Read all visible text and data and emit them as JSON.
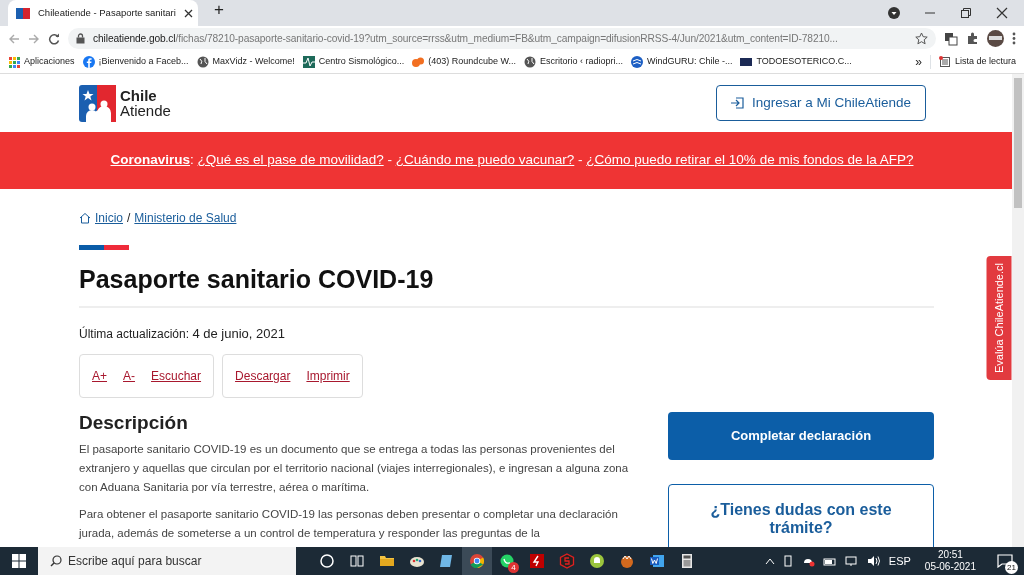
{
  "browser": {
    "tabs": [
      {
        "title": "Chileatiende - Pasaporte sanitari",
        "selected": true
      }
    ],
    "new_tab": "+",
    "url_host": "chileatiende.gob.cl",
    "url_path": "/fichas/78210-pasaporte-sanitario-covid-19?utm_source=rrss&utm_medium=FB&utm_campaign=difusionRRSS-4/Jun/2021&utm_content=ID-78210...",
    "bookmarks": [
      {
        "label": "Aplicaciones",
        "kind": "apps"
      },
      {
        "label": "¡Bienvenido a Faceb...",
        "kind": "social"
      },
      {
        "label": "MaxVidz - Welcome!",
        "kind": "globe"
      },
      {
        "label": "Centro Sismológico...",
        "kind": "seismo"
      },
      {
        "label": "(403) Roundcube W...",
        "kind": "mail"
      },
      {
        "label": "Escritorio ‹ radiopri...",
        "kind": "globe"
      },
      {
        "label": "WindGURU: Chile -...",
        "kind": "wind"
      },
      {
        "label": "TODOESOTERICO.C...",
        "kind": "badge"
      }
    ],
    "overflow": "»",
    "reading_list": "Lista de lectura"
  },
  "site": {
    "logo_top": "Chile",
    "logo_bottom": "Atiende",
    "login_button": "Ingresar a Mi ChileAtiende",
    "alert": [
      {
        "kind": "strong-link",
        "text": "Coronavirus"
      },
      {
        "kind": "text",
        "text": ": "
      },
      {
        "kind": "link",
        "text": "¿Qué es el pase de movilidad?"
      },
      {
        "kind": "text",
        "text": " - "
      },
      {
        "kind": "link",
        "text": "¿Cuándo me puedo vacunar?"
      },
      {
        "kind": "text",
        "text": " - "
      },
      {
        "kind": "link",
        "text": "¿Cómo puedo retirar el 10% de mis fondos de la AFP?"
      }
    ],
    "breadcrumb": [
      {
        "label": "Inicio"
      },
      {
        "label": "Ministerio de Salud"
      }
    ],
    "breadcrumb_separator": "/",
    "title": "Pasaporte sanitario COVID-19",
    "updated_label": "Última actualización:",
    "updated_value": "4 de junio, 2021",
    "tool_groups": [
      [
        "A+",
        "A-",
        "Escuchar"
      ],
      [
        "Descargar",
        "Imprimir"
      ]
    ],
    "section_heading": "Descripción",
    "paragraphs": [
      "El pasaporte sanitario COVID-19 es un documento que se entrega a todas las personas provenientes del extranjero y aquellas que circulan por el territorio nacional (viajes interregionales), e ingresan a alguna zona con Aduana Sanitaria por vía terrestre, aérea o marítima.",
      "Para obtener el pasaporte sanitario COVID-19 las personas deben presentar o completar una declaración jurada, además de someterse a un control de temperatura y responder las preguntas de la"
    ],
    "primary_button": "Completar declaración",
    "help_heading": "¿Tienes dudas con este trámite?",
    "feedback_tab": "Evalúa ChileAtiende.cl"
  },
  "taskbar": {
    "search_placeholder": "Escribe aquí para buscar",
    "apps": [
      {
        "kind": "cortana",
        "selected": false
      },
      {
        "kind": "taskview",
        "selected": false
      },
      {
        "kind": "folder",
        "selected": false
      },
      {
        "kind": "paint",
        "selected": false
      },
      {
        "kind": "notes",
        "selected": false
      },
      {
        "kind": "chrome",
        "selected": true
      },
      {
        "kind": "chat",
        "selected": false,
        "badge": "4"
      },
      {
        "kind": "ftp",
        "selected": false
      },
      {
        "kind": "red",
        "selected": false
      },
      {
        "kind": "green",
        "selected": false
      },
      {
        "kind": "glove",
        "selected": false
      },
      {
        "kind": "word",
        "selected": false
      },
      {
        "kind": "calc",
        "selected": false
      }
    ],
    "language": "ESP",
    "time": "20:51",
    "date": "05-06-2021",
    "notifications": "21"
  }
}
